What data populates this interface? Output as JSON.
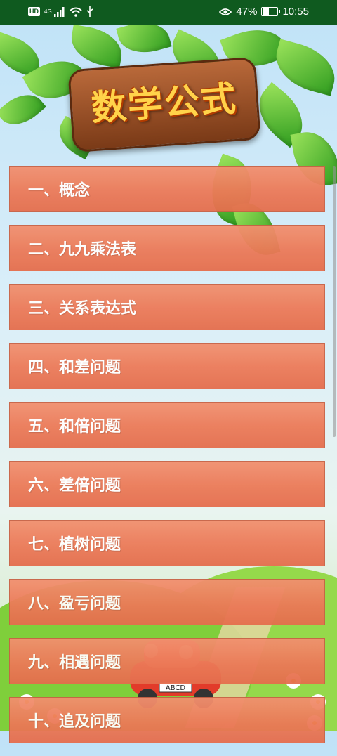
{
  "status_bar": {
    "hd": "HD",
    "network": "4G",
    "battery_percent": "47%",
    "battery_level": 0.47,
    "time": "10:55",
    "icons": [
      "signal-icon",
      "wifi-icon",
      "usb-icon",
      "eye-icon",
      "battery-icon"
    ]
  },
  "title": "数学公式",
  "menu": [
    {
      "label": "一、概念"
    },
    {
      "label": "二、九九乘法表"
    },
    {
      "label": "三、关系表达式"
    },
    {
      "label": "四、和差问题"
    },
    {
      "label": "五、和倍问题"
    },
    {
      "label": "六、差倍问题"
    },
    {
      "label": "七、植树问题"
    },
    {
      "label": "八、盈亏问题"
    },
    {
      "label": "九、相遇问题"
    },
    {
      "label": "十、追及问题"
    }
  ],
  "car_plate": "ABCD",
  "colors": {
    "status_bar": "#0f5a1f",
    "menu_item": "#ec7a58",
    "title_text": "#ffd34a",
    "sign_wood": "#9a5226"
  }
}
